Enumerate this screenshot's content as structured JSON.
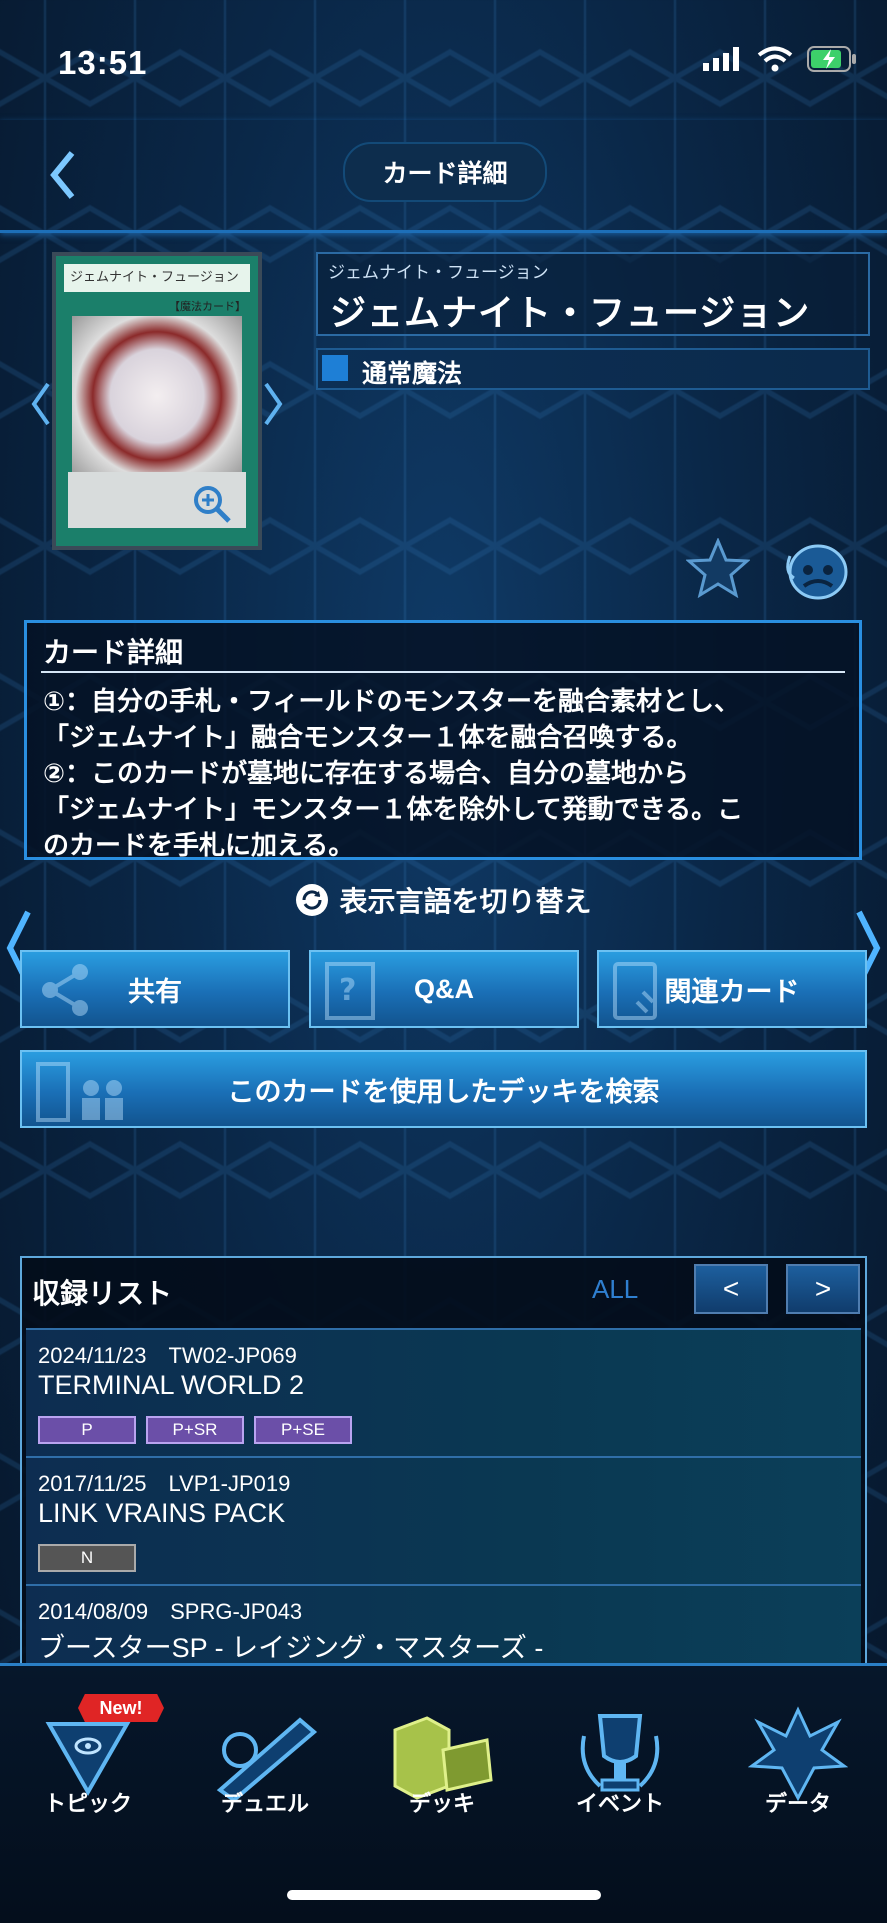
{
  "status_bar": {
    "time": "13:51"
  },
  "header": {
    "title": "カード詳細"
  },
  "card": {
    "image_name_text": "ジェムナイト・フュージョン",
    "image_type_text": "【魔法カード】",
    "ruby": "ジェムナイト・フュージョン",
    "name": "ジェムナイト・フュージョン",
    "type": "通常魔法"
  },
  "detail": {
    "title": "カード詳細",
    "text": "①：自分の手札・フィールドのモンスターを融合素材とし、\n「ジェムナイト」融合モンスター１体を融合召喚する。\n②：このカードが墓地に存在する場合、自分の墓地から\n「ジェムナイト」モンスター１体を除外して発動できる。こ\nのカードを手札に加える。"
  },
  "lang_toggle": "表示言語を切り替え",
  "buttons": {
    "share": "共有",
    "qa": "Q&A",
    "related": "関連カード",
    "deck_search": "このカードを使用したデッキを検索"
  },
  "list": {
    "title": "収録リスト",
    "filter": "ALL",
    "prev": "<",
    "next": ">",
    "rows": [
      {
        "meta": "2024/11/23　TW02-JP069",
        "name": "TERMINAL WORLD 2",
        "rarities": [
          "P",
          "P+SR",
          "P+SE"
        ]
      },
      {
        "meta": "2017/11/25　LVP1-JP019",
        "name": "LINK VRAINS PACK",
        "rarities": [
          "N"
        ]
      },
      {
        "meta": "2014/08/09　SPRG-JP043",
        "name": "ブースターSP - レイジング・マスターズ -",
        "rarities": []
      }
    ]
  },
  "tabs": [
    {
      "label": "トピック",
      "badge": "New!"
    },
    {
      "label": "デュエル"
    },
    {
      "label": "デッキ"
    },
    {
      "label": "イベント"
    },
    {
      "label": "データ"
    }
  ],
  "colors": {
    "accent": "#2a8fe0",
    "rarity_purple": "#6b4fa8",
    "rarity_gray": "#555555"
  }
}
